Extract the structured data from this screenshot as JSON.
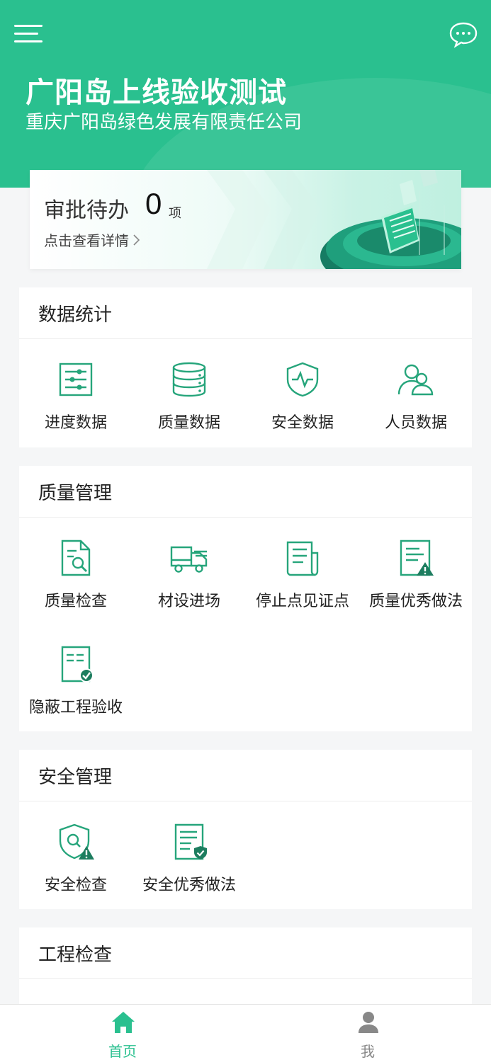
{
  "header": {
    "title": "广阳岛上线验收测试",
    "subtitle": "重庆广阳岛绿色发展有限责任公司"
  },
  "todo": {
    "title": "审批待办",
    "count": "0",
    "unit": "项",
    "link": "点击查看详情"
  },
  "sections": {
    "stats": {
      "title": "数据统计",
      "items": [
        "进度数据",
        "质量数据",
        "安全数据",
        "人员数据"
      ]
    },
    "quality": {
      "title": "质量管理",
      "items": [
        "质量检查",
        "材设进场",
        "停止点见证点",
        "质量优秀做法",
        "隐蔽工程验收"
      ]
    },
    "safety": {
      "title": "安全管理",
      "items": [
        "安全检查",
        "安全优秀做法"
      ]
    },
    "engineering": {
      "title": "工程检查"
    }
  },
  "tabbar": {
    "home": "首页",
    "me": "我"
  },
  "colors": {
    "brand": "#2ac08f",
    "icon": "#26a57b",
    "tab_active": "#2ac08f",
    "tab_inactive": "#888888"
  }
}
